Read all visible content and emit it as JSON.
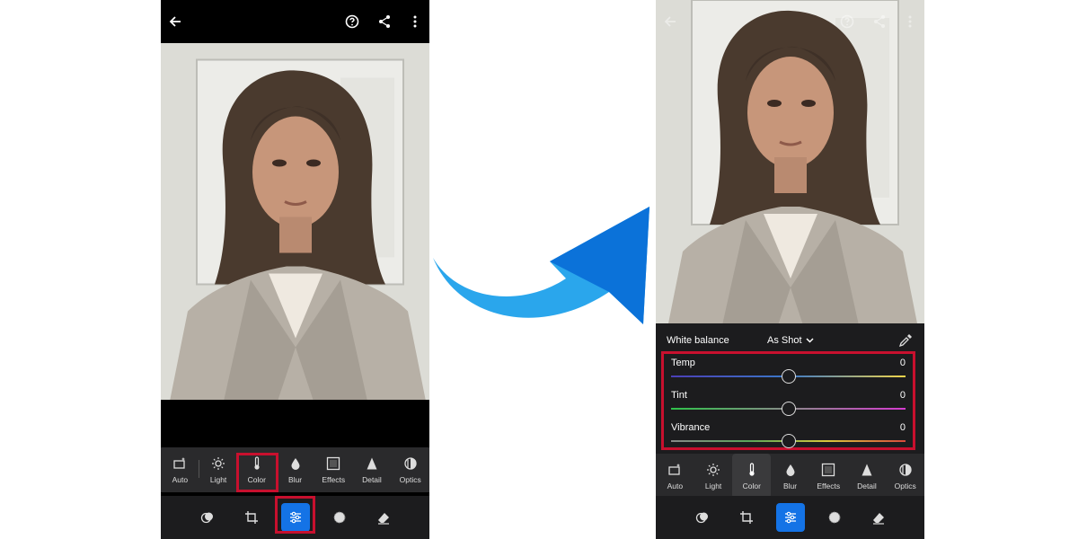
{
  "colors": {
    "accent": "#1473e6",
    "highlight": "#c8102e",
    "arrow_light": "#2aa6ec",
    "arrow_dark": "#0b72d9"
  },
  "left_phone": {
    "tools": [
      {
        "label": "Auto",
        "icon": "auto-icon"
      },
      {
        "label": "Light",
        "icon": "sun-icon"
      },
      {
        "label": "Color",
        "icon": "thermometer-icon"
      },
      {
        "label": "Blur",
        "icon": "drop-icon"
      },
      {
        "label": "Effects",
        "icon": "effects-icon"
      },
      {
        "label": "Detail",
        "icon": "triangle-icon"
      },
      {
        "label": "Optics",
        "icon": "lens-icon"
      }
    ]
  },
  "right_phone": {
    "white_balance": {
      "label": "White balance",
      "value": "As Shot"
    },
    "sliders": [
      {
        "name": "Temp",
        "value": "0",
        "level": 0.5
      },
      {
        "name": "Tint",
        "value": "0",
        "level": 0.5
      },
      {
        "name": "Vibrance",
        "value": "0",
        "level": 0.5
      }
    ],
    "tools": [
      {
        "label": "Auto",
        "icon": "auto-icon"
      },
      {
        "label": "Light",
        "icon": "sun-icon"
      },
      {
        "label": "Color",
        "icon": "thermometer-icon"
      },
      {
        "label": "Blur",
        "icon": "drop-icon"
      },
      {
        "label": "Effects",
        "icon": "effects-icon"
      },
      {
        "label": "Detail",
        "icon": "triangle-icon"
      },
      {
        "label": "Optics",
        "icon": "lens-icon"
      }
    ]
  }
}
